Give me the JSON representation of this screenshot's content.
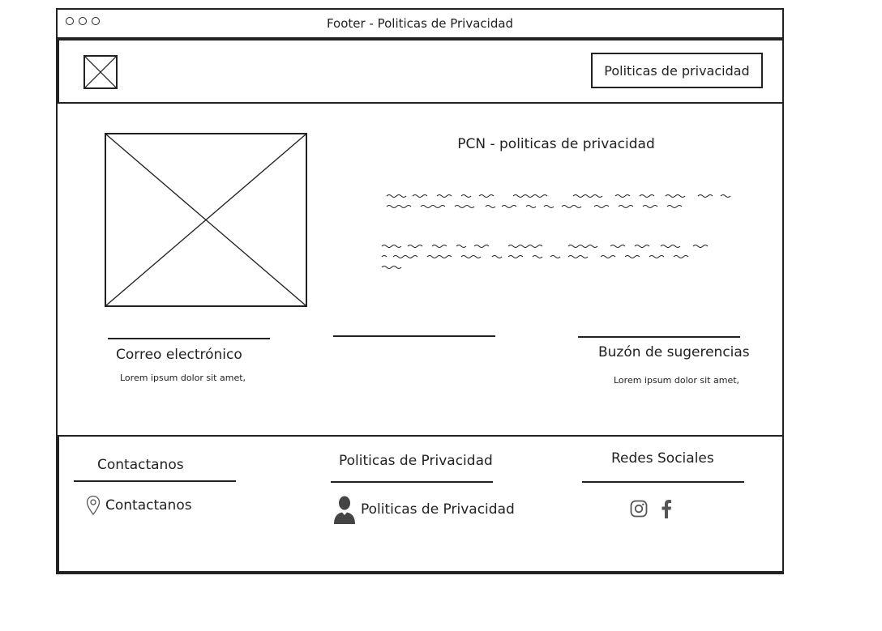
{
  "window": {
    "title": "Footer - Politicas de Privacidad"
  },
  "header": {
    "nav_button_label": "Politicas de privacidad",
    "logo_icon": "image-placeholder-icon"
  },
  "main": {
    "hero_icon": "image-placeholder-icon",
    "section_title": "PCN - politicas de privacidad",
    "columns": [
      {
        "title": "Correo electrónico",
        "text": "Lorem ipsum dolor sit amet,"
      },
      {
        "title": "",
        "text": ""
      },
      {
        "title": "Buzón de sugerencias",
        "text": "Lorem ipsum dolor sit amet,"
      }
    ]
  },
  "footer": {
    "columns": [
      {
        "heading": "Contactanos",
        "link_label": "Contactanos",
        "icon": "location-pin-icon"
      },
      {
        "heading": "Politicas de Privacidad",
        "link_label": "Politicas de Privacidad",
        "icon": "user-icon"
      },
      {
        "heading": "Redes Sociales",
        "icons": [
          "instagram-icon",
          "facebook-icon"
        ]
      }
    ]
  },
  "colors": {
    "line": "#222222",
    "icon_gray": "#555555",
    "background": "#ffffff"
  }
}
